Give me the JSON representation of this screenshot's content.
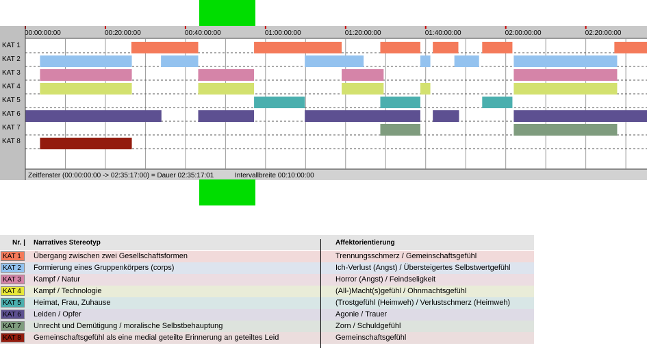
{
  "chart_data": {
    "type": "timeline",
    "x_unit": "seconds",
    "x_range": [
      0,
      9317
    ],
    "ticks": [
      {
        "t": 0,
        "label": "00:00:00:00"
      },
      {
        "t": 1200,
        "label": "00:20:00:00"
      },
      {
        "t": 2400,
        "label": "00:40:00:00"
      },
      {
        "t": 3600,
        "label": "01:00:00:00"
      },
      {
        "t": 4800,
        "label": "01:20:00:00"
      },
      {
        "t": 6000,
        "label": "01:40:00:00"
      },
      {
        "t": 7200,
        "label": "02:00:00:00"
      },
      {
        "t": 8400,
        "label": "02:20:00:00"
      }
    ],
    "rows": [
      {
        "label": "KAT 1",
        "color": "#f47a5a",
        "segments": [
          [
            1589,
            2591
          ],
          [
            3428,
            4741
          ],
          [
            5320,
            5920
          ],
          [
            6107,
            6490
          ],
          [
            6847,
            7300
          ],
          [
            8828,
            9317
          ]
        ]
      },
      {
        "label": "KAT 2",
        "color": "#93c2ef",
        "segments": [
          [
            220,
            1596
          ],
          [
            2033,
            2591
          ],
          [
            4188,
            5070
          ],
          [
            5920,
            6070
          ],
          [
            6430,
            6800
          ],
          [
            7320,
            8870
          ]
        ]
      },
      {
        "label": "KAT 3",
        "color": "#d584a8",
        "segments": [
          [
            220,
            1596
          ],
          [
            2591,
            3428
          ],
          [
            4741,
            5370
          ],
          [
            7320,
            8870
          ]
        ]
      },
      {
        "label": "KAT 4",
        "color": "#d3e16f",
        "segments": [
          [
            220,
            1596
          ],
          [
            2591,
            3428
          ],
          [
            4741,
            5370
          ],
          [
            5920,
            6070
          ],
          [
            7320,
            8870
          ]
        ]
      },
      {
        "label": "KAT 5",
        "color": "#4aafae",
        "segments": [
          [
            3428,
            4188
          ],
          [
            5320,
            5920
          ],
          [
            6847,
            7300
          ]
        ]
      },
      {
        "label": "KAT 6",
        "color": "#5d5091",
        "segments": [
          [
            0,
            2040
          ],
          [
            2591,
            3428
          ],
          [
            4188,
            5920
          ],
          [
            6107,
            6500
          ],
          [
            7320,
            9317
          ]
        ]
      },
      {
        "label": "KAT 7",
        "color": "#7f9c7e",
        "segments": [
          [
            5320,
            5920
          ],
          [
            7320,
            8870
          ]
        ]
      },
      {
        "label": "KAT 8",
        "color": "#931b0e",
        "segments": [
          [
            220,
            1596
          ]
        ]
      }
    ],
    "status": {
      "window": "Zeitfenster (00:00:00:00 -> 02:35:17:00) = Dauer 02:35:17:01",
      "interval": "Intervallbreite 00:10:00:00"
    }
  },
  "legend": {
    "headers": {
      "nr": "Nr. |",
      "stereotype": "Narratives Stereotyp",
      "affect": "Affektorientierung"
    },
    "rows": [
      {
        "kat": "KAT 1",
        "color": "#f47a5a",
        "bg": "#f1dada",
        "stereotype": "Übergang zwischen zwei Gesellschaftsformen",
        "affect": "Trennungsschmerz / Gemeinschaftsgefühl"
      },
      {
        "kat": "KAT 2",
        "color": "#93c2ef",
        "bg": "#dde4ee",
        "stereotype": "Formierung eines Gruppenkörpers (corps)",
        "affect": "Ich-Verlust (Angst) / Übersteigertes Selbstwertgefühl"
      },
      {
        "kat": "KAT 3",
        "color": "#d584a8",
        "bg": "#ecdde2",
        "stereotype": "Kampf / Natur",
        "affect": "Horror (Angst) / Feindseligkeit"
      },
      {
        "kat": "KAT 4",
        "color": "#e8e83a",
        "bg": "#e9ecd8",
        "stereotype": "Kampf / Technologie",
        "affect": "(All-)Macht(s)gefühl / Ohnmachtsgefühl"
      },
      {
        "kat": "KAT 5",
        "color": "#4aafae",
        "bg": "#d8e6e6",
        "stereotype": "Heimat, Frau, Zuhause",
        "affect": "(Trostgefühl (Heimweh) / Verlustschmerz (Heimweh)"
      },
      {
        "kat": "KAT 6",
        "color": "#5d5091",
        "bg": "#dedbe6",
        "stereotype": "Leiden / Opfer",
        "affect": "Agonie / Trauer"
      },
      {
        "kat": "KAT 7",
        "color": "#7f9c7e",
        "bg": "#dde3dd",
        "stereotype": "Unrecht und Demütigung / moralische Selbstbehauptung",
        "affect": "Zorn / Schuldgefühl"
      },
      {
        "kat": "KAT 8",
        "color": "#931b0e",
        "bg": "#ebdddd",
        "stereotype": "Gemeinschaftsgefühl als eine medial geteilte Erinnerung an geteiltes Leid",
        "affect": "Gemeinschaftsgefühl"
      }
    ]
  }
}
